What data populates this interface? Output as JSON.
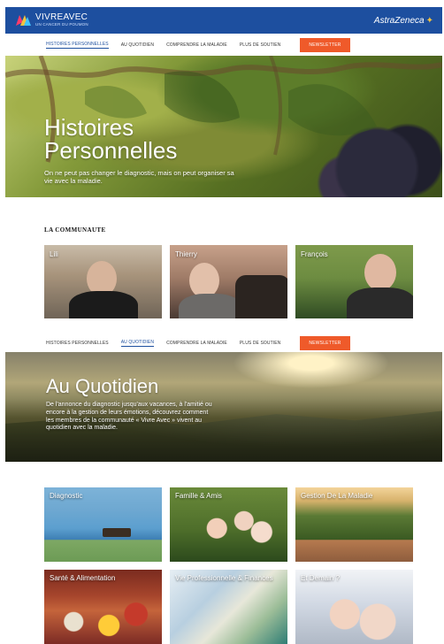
{
  "header": {
    "logo_title": "VIVREAVEC",
    "logo_subtitle": "UN CANCER DU POUMON",
    "brand": "AstraZeneca"
  },
  "nav": {
    "items": [
      "Histoires personnelles",
      "Au quotidien",
      "Comprendre la maladie",
      "Plus de soutien"
    ],
    "cta": "Newsletter"
  },
  "hero1": {
    "title_line1": "Histoires",
    "title_line2": "Personnelles",
    "subtitle": "On ne peut pas changer le diagnostic, mais on peut organiser sa vie avec la maladie."
  },
  "community": {
    "title": "LA COMMUNAUTE",
    "people": [
      {
        "name": "Lili"
      },
      {
        "name": "Thierry"
      },
      {
        "name": "François"
      }
    ]
  },
  "hero2": {
    "title": "Au Quotidien",
    "subtitle": "De l'annonce du diagnostic jusqu'aux vacances, à l'amitié ou encore à la gestion de leurs émotions, découvrez comment les membres de la communauté « Vivre Avec » vivent au quotidien avec la maladie."
  },
  "topics": [
    {
      "label": "Diagnostic"
    },
    {
      "label": "Famille & Amis"
    },
    {
      "label": "Gestion De La Maladie"
    },
    {
      "label": "Santé & Alimentation"
    },
    {
      "label": "Vie Professionnelle & Finances"
    },
    {
      "label": "Et Demain ?"
    }
  ],
  "colors": {
    "header_blue": "#1d4f9f",
    "cta_orange": "#ef5a2a"
  }
}
